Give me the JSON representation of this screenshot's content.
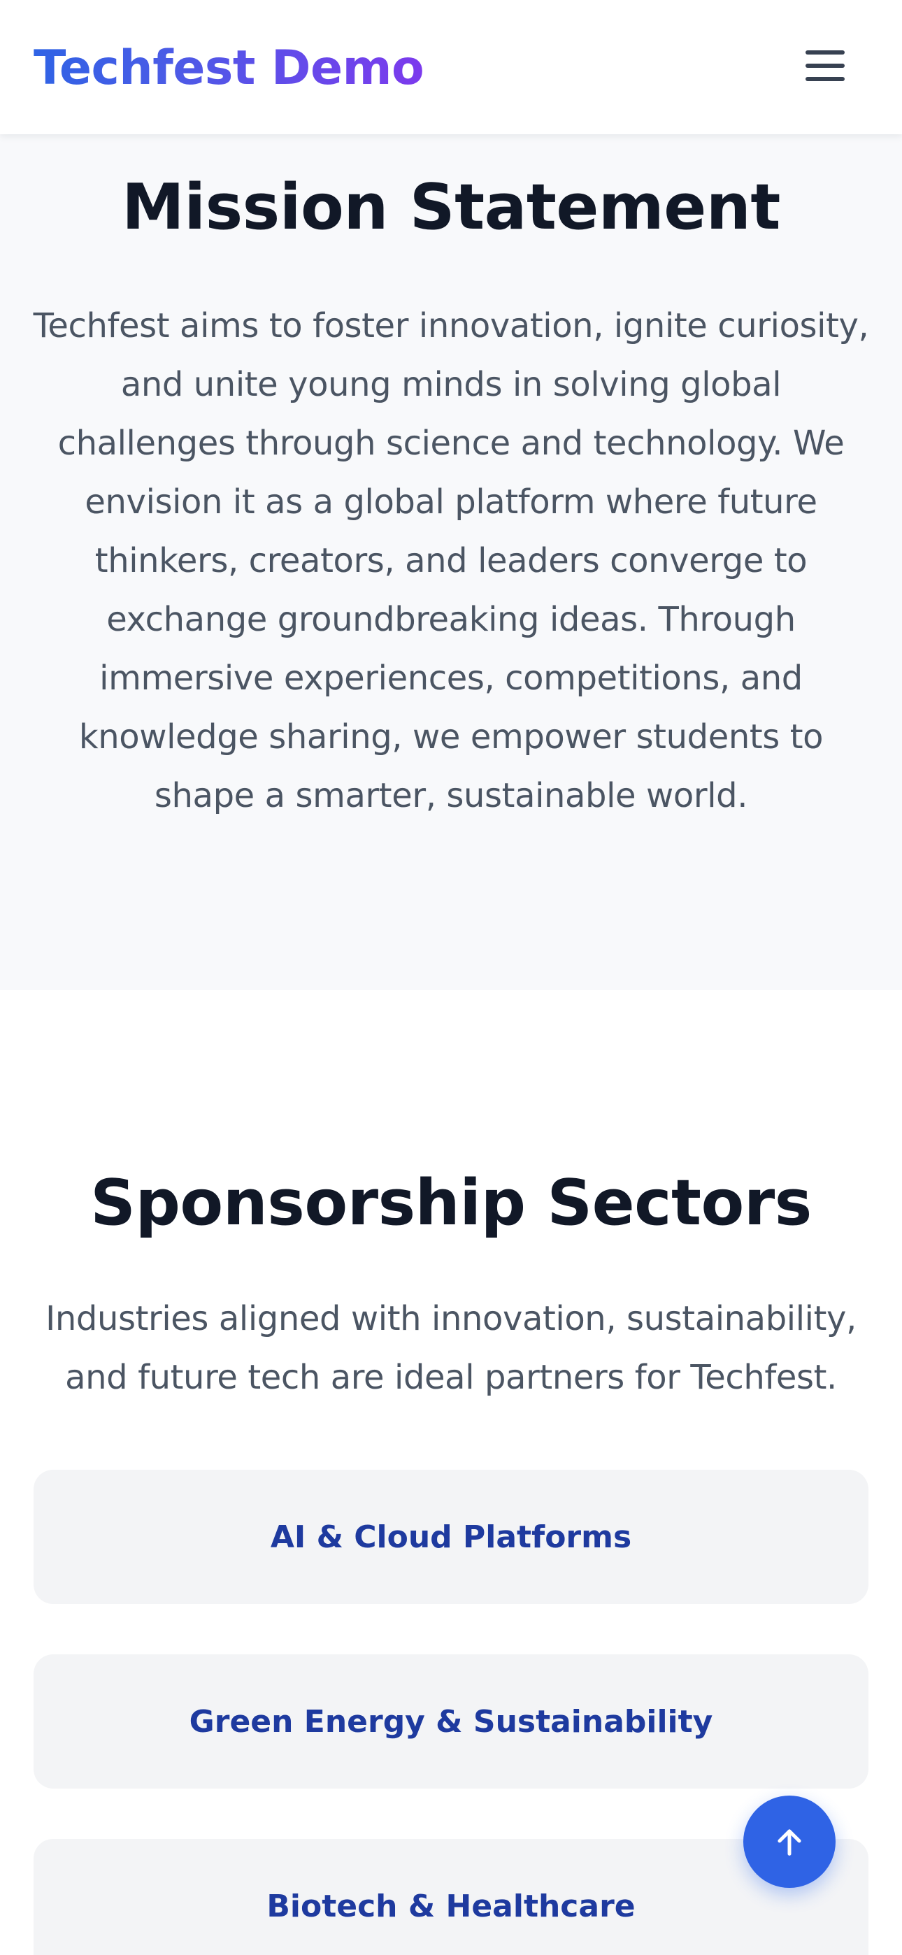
{
  "header": {
    "brand": "Techfest Demo",
    "menu_icon": "hamburger-menu-icon"
  },
  "mission": {
    "title": "Mission Statement",
    "body": "Techfest aims to foster innovation, ignite curiosity, and unite young minds in solving global challenges through science and technology. We envision it as a global platform where future thinkers, creators, and leaders converge to exchange groundbreaking ideas. Through immersive experiences, competitions, and knowledge sharing, we empower students to shape a smarter, sustainable world."
  },
  "sponsorship": {
    "title": "Sponsorship Sectors",
    "subtitle": "Industries aligned with innovation, sustainability, and future tech are ideal partners for Techfest.",
    "sectors": [
      {
        "label": "AI & Cloud Platforms"
      },
      {
        "label": "Green Energy & Sustainability"
      },
      {
        "label": "Biotech & Healthcare"
      }
    ]
  },
  "scroll_top": {
    "icon": "arrow-up-icon"
  },
  "colors": {
    "brand_gradient_start": "#2f63e5",
    "brand_gradient_end": "#7c3aed",
    "accent": "#2f63e5",
    "sector_label": "#1e3a9f",
    "card_background": "#f3f4f6"
  }
}
